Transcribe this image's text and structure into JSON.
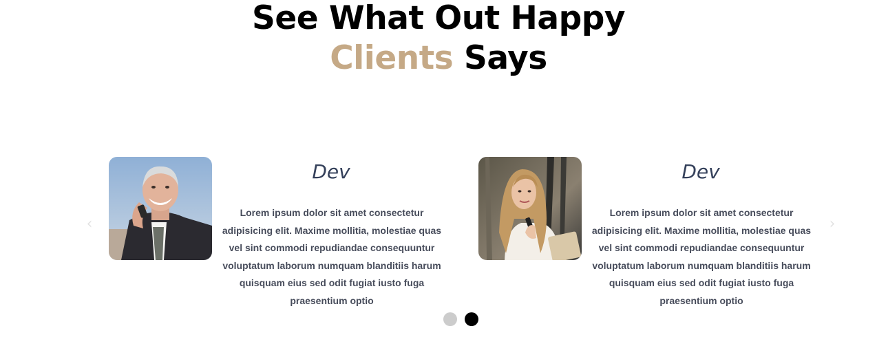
{
  "heading": {
    "line1": "See What Out Happy",
    "accent": "Clients",
    "rest": " Says",
    "accent_color": "#c5a986"
  },
  "carousel": {
    "prev_icon": "chevron-left-icon",
    "next_icon": "chevron-right-icon",
    "prev_glyph": "‹",
    "next_glyph": "›",
    "slides": [
      {
        "photo": "man-on-phone-photo",
        "name": "Dev",
        "quote": "Lorem ipsum dolor sit amet consectetur adipisicing elit. Maxime mollitia, molestiae quas vel sint commodi repudiandae consequuntur voluptatum laborum numquam blanditiis harum quisquam eius sed odit fugiat iusto fuga praesentium optio"
      },
      {
        "photo": "woman-with-phone-photo",
        "name": "Dev",
        "quote": "Lorem ipsum dolor sit amet consectetur adipisicing elit. Maxime mollitia, molestiae quas vel sint commodi repudiandae consequuntur voluptatum laborum numquam blanditiis harum quisquam eius sed odit fugiat iusto fuga praesentium optio"
      }
    ],
    "pagination": {
      "count": 2,
      "active": 2,
      "inactive_color": "#cccccc",
      "active_color": "#000000"
    }
  }
}
